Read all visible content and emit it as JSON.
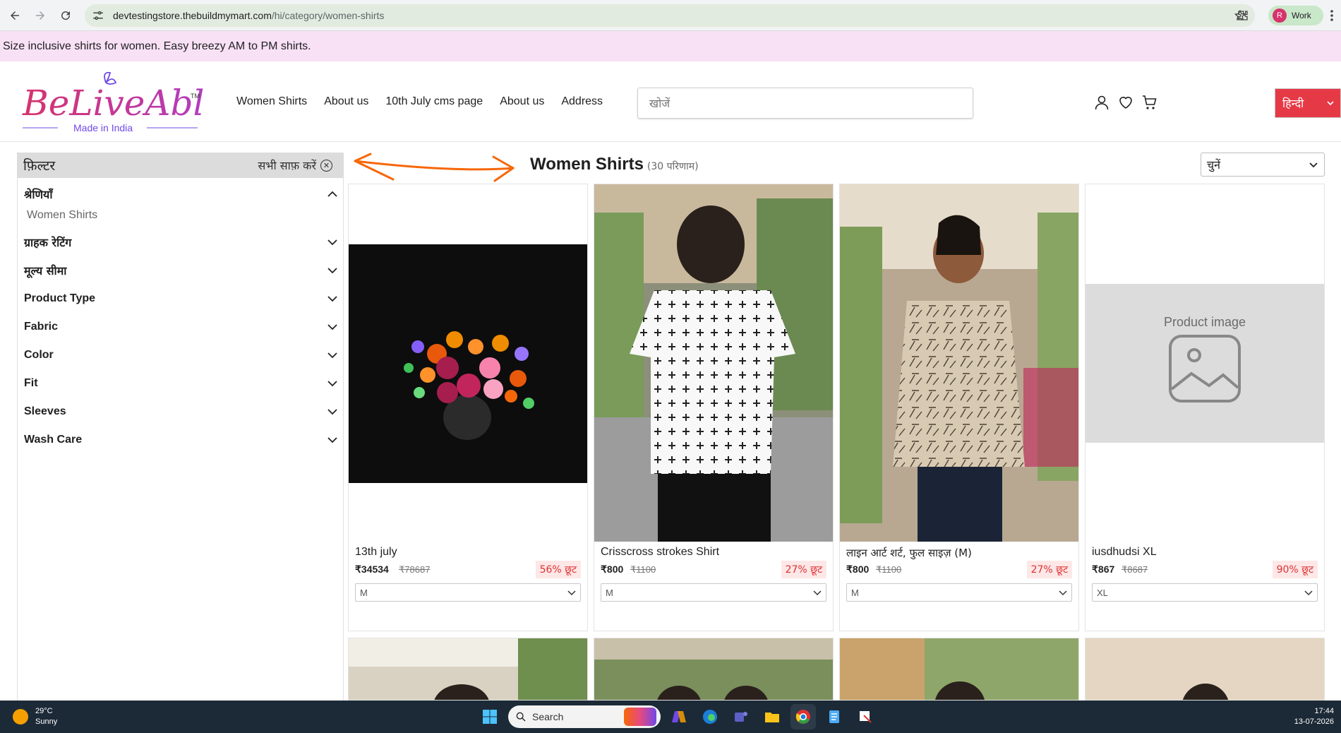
{
  "browser": {
    "url_host": "devtestingstore.thebuildmymart.com",
    "url_path": "/hi/category/women-shirts",
    "profile_initial": "R",
    "profile_label": "Work",
    "icons": [
      "back-icon",
      "forward-icon",
      "reload-icon",
      "site-settings-icon",
      "bookmark-star-icon",
      "extensions-icon",
      "menu-icon"
    ]
  },
  "announcement": "Size inclusive shirts for women. Easy breezy AM to PM shirts.",
  "header": {
    "logo_text": "BeLiveAble",
    "logo_tm": "TM",
    "logo_sub": "Made in India",
    "nav": [
      "Women Shirts",
      "About us",
      "10th July cms page",
      "About us",
      "Address"
    ],
    "search_placeholder": "खोजें",
    "language": "हिन्दी",
    "icons": [
      "account-icon",
      "wishlist-heart-icon",
      "cart-icon"
    ],
    "accent_color": "#e63946",
    "brand_colors": [
      "#d6336c",
      "#7048e8"
    ]
  },
  "filters": {
    "title": "फ़िल्टर",
    "clear_all": "सभी साफ़ करें",
    "facets": [
      {
        "label": "श्रेणियाँ",
        "expanded": true
      },
      {
        "label": "ग्राहक रेटिंग",
        "expanded": false
      },
      {
        "label": "मूल्य सीमा",
        "expanded": false
      },
      {
        "label": "Product Type",
        "expanded": false
      },
      {
        "label": "Fabric",
        "expanded": false
      },
      {
        "label": "Color",
        "expanded": false
      },
      {
        "label": "Fit",
        "expanded": false
      },
      {
        "label": "Sleeves",
        "expanded": false
      },
      {
        "label": "Wash Care",
        "expanded": false
      }
    ],
    "category_option": "Women Shirts"
  },
  "results": {
    "title": "Women Shirts",
    "count": "(30 परिणाम)",
    "sort_label": "चुनें"
  },
  "products": [
    {
      "name": "13th july",
      "price": "₹34534",
      "mrp": "₹78687",
      "discount": "56% छूट",
      "size": "M",
      "image": "flower-bouquet"
    },
    {
      "name": "Crisscross strokes Shirt",
      "price": "₹800",
      "mrp": "₹1100",
      "discount": "27% छूट",
      "size": "M",
      "image": "model-back-white-shirt"
    },
    {
      "name": "लाइन आर्ट शर्ट, फुल साइज़ (M)",
      "price": "₹800",
      "mrp": "₹1100",
      "discount": "27% छूट",
      "size": "M",
      "image": "model-front-print-shirt"
    },
    {
      "name": "iusdhudsi XL",
      "price": "₹867",
      "mrp": "₹8687",
      "discount": "90% छूट",
      "size": "XL",
      "image": "placeholder",
      "placeholder_text": "Product image"
    }
  ],
  "taskbar": {
    "temp": "29°C",
    "weather": "Sunny",
    "search": "Search",
    "time": "17:44",
    "date": "13-07-2026"
  }
}
